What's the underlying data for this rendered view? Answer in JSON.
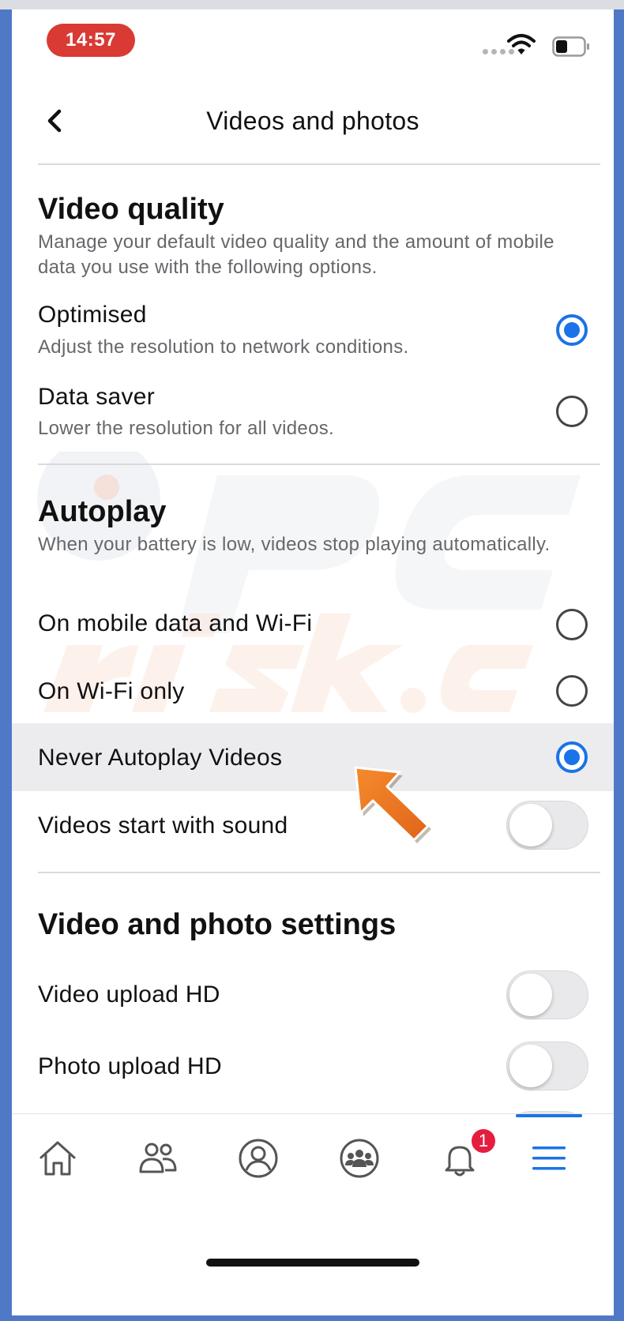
{
  "status_bar": {
    "time": "14:57"
  },
  "header": {
    "title": "Videos and photos"
  },
  "video_quality": {
    "title": "Video quality",
    "description": "Manage your default video quality and the amount of mobile data you use with the following options.",
    "options": [
      {
        "label": "Optimised",
        "sublabel": "Adjust the resolution to network conditions.",
        "selected": true
      },
      {
        "label": "Data saver",
        "sublabel": "Lower the resolution for all videos.",
        "selected": false
      }
    ]
  },
  "autoplay": {
    "title": "Autoplay",
    "description": "When your battery is low, videos stop playing automatically.",
    "options": [
      {
        "label": "On mobile data and Wi-Fi",
        "selected": false
      },
      {
        "label": "On Wi-Fi only",
        "selected": false
      },
      {
        "label": "Never Autoplay Videos",
        "selected": true
      }
    ],
    "sound_toggle": {
      "label": "Videos start with sound",
      "on": false
    }
  },
  "photo_settings": {
    "title": "Video and photo settings",
    "toggles": [
      {
        "label": "Video upload HD",
        "on": false
      },
      {
        "label": "Photo upload HD",
        "on": false
      }
    ]
  },
  "bottom_nav": {
    "items": [
      "home-icon",
      "friends-icon",
      "profile-icon",
      "groups-icon",
      "notifications-icon",
      "menu-icon"
    ],
    "notification_count": "1",
    "active": "menu-icon"
  },
  "colors": {
    "accent": "#1a73e8",
    "status_pill": "#d93a33",
    "badge": "#e41e3f",
    "arrow": "#f07a1f"
  }
}
